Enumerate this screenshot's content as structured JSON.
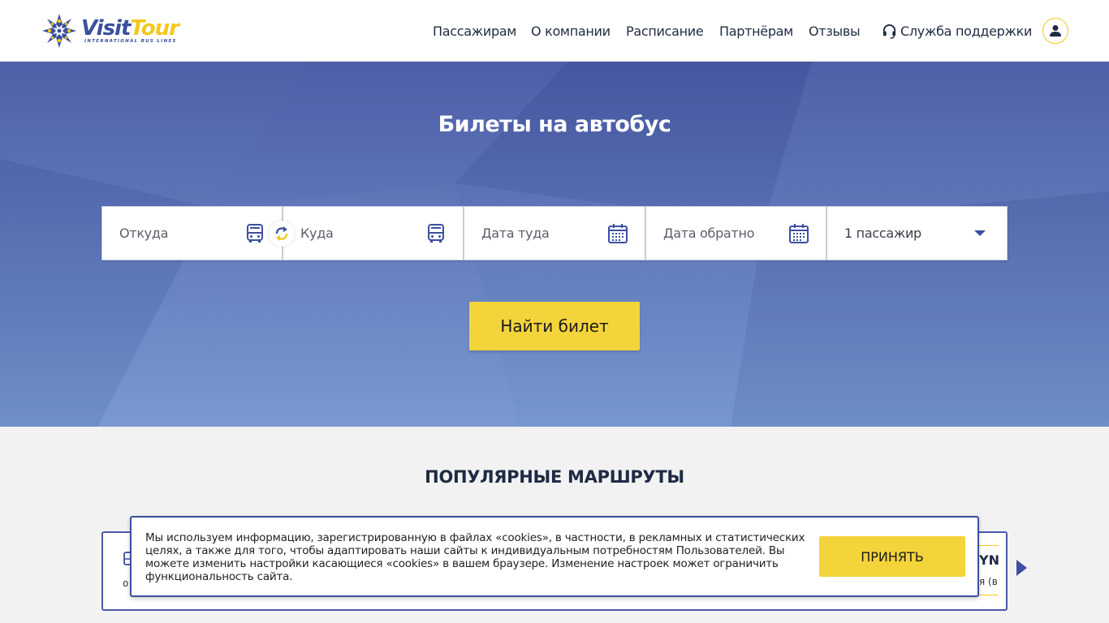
{
  "brand": {
    "name_part1": "Visit",
    "name_part2": "Tour",
    "tagline": "INTERNATIONAL BUS LINES"
  },
  "nav": {
    "items": [
      {
        "label": "Пассажирам"
      },
      {
        "label": "О компании"
      },
      {
        "label": "Расписание"
      },
      {
        "label": "Партнёрам"
      },
      {
        "label": "Отзывы"
      }
    ],
    "support_label": "Служба поддержки",
    "support_icon": "headset-icon",
    "user_icon": "user-icon"
  },
  "hero": {
    "title": "Билеты на автобус"
  },
  "search": {
    "from_placeholder": "Откуда",
    "to_placeholder": "Куда",
    "date_there_placeholder": "Дата туда",
    "date_back_placeholder": "Дата обратно",
    "passengers_value": "1 пассажир",
    "find_button": "Найти билет"
  },
  "routes": {
    "title": "ПОПУЛЯРНЫЕ МАРШРУТЫ",
    "peek_right_code": "YN",
    "peek_right_sub": "я (в"
  },
  "cookie": {
    "text": "Мы используем информацию, зарегистрированную в файлах «cookies», в частности, в рекламных и статистических целях, а также для того, чтобы адаптировать наши сайты к индивидуальным потребностям Пользователей. Вы можете изменить настройки касающиеся «cookies» в вашем браузере. Изменение настроек может ограничить функциональность сайта.",
    "accept_label": "ПРИНЯТЬ"
  },
  "colors": {
    "brand_blue": "#3a4f9e",
    "brand_yellow": "#f3c81c",
    "button_yellow": "#f3d43a",
    "hero_top": "#4859a6",
    "hero_bottom": "#7394d0"
  }
}
